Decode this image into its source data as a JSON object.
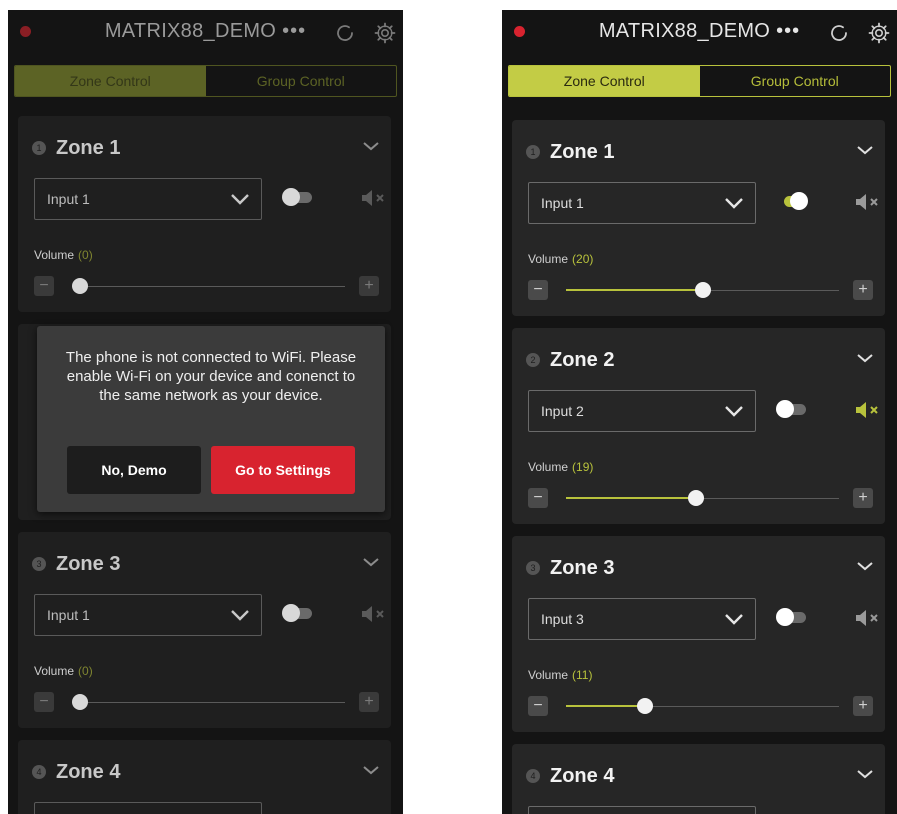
{
  "app": {
    "title": "MATRIX88_DEMO",
    "menu_dots": "•••",
    "tabs": [
      {
        "label": "Zone Control",
        "active": true
      },
      {
        "label": "Group Control",
        "active": false
      }
    ],
    "volume_label": "Volume",
    "decrease_symbol": "−",
    "increase_symbol": "+"
  },
  "colors": {
    "accent": "#c3cc45",
    "alert_red": "#d8232f",
    "background": "#141414",
    "card": "#262626"
  },
  "icons": {
    "refresh": "refresh-icon",
    "settings": "gear-icon",
    "expand": "chevron-down-icon",
    "mute": "speaker-mute-icon"
  },
  "left_screen": {
    "zones": [
      {
        "number": "1",
        "name": "Zone 1",
        "input": "Input 1",
        "enabled": false,
        "muted": true,
        "volume": 0,
        "volume_display": "(0)"
      },
      {
        "number": "3",
        "name": "Zone 3",
        "input": "Input 1",
        "enabled": false,
        "muted": true,
        "volume": 0,
        "volume_display": "(0)"
      },
      {
        "number": "4",
        "name": "Zone 4"
      }
    ],
    "dialog": {
      "message": "The phone is not connected to WiFi. Please enable Wi-Fi on your device and conenct to the same network as your device.",
      "secondary_button": "No, Demo",
      "primary_button": "Go to Settings"
    }
  },
  "right_screen": {
    "zones": [
      {
        "number": "1",
        "name": "Zone 1",
        "input": "Input 1",
        "enabled": true,
        "muted": true,
        "volume": 20,
        "volume_display": "(20)"
      },
      {
        "number": "2",
        "name": "Zone 2",
        "input": "Input 2",
        "enabled": false,
        "muted": true,
        "volume": 19,
        "volume_display": "(19)"
      },
      {
        "number": "3",
        "name": "Zone 3",
        "input": "Input 3",
        "enabled": false,
        "muted": true,
        "volume": 11,
        "volume_display": "(11)"
      },
      {
        "number": "4",
        "name": "Zone 4"
      }
    ]
  }
}
